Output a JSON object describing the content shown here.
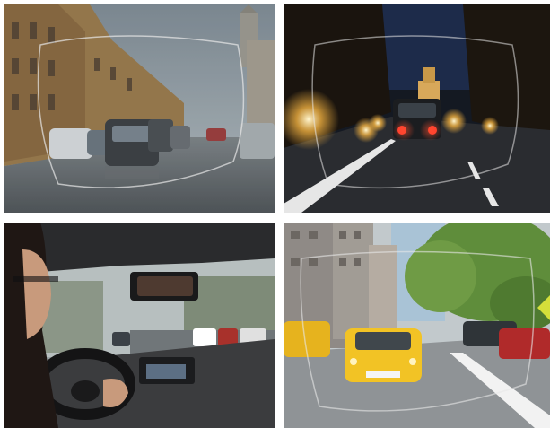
{
  "tiles": [
    {
      "scene": "rainy-city-street-through-lens"
    },
    {
      "scene": "night-street-headlights-through-lens"
    },
    {
      "scene": "car-interior-driver-rain"
    },
    {
      "scene": "taxi-city-street-through-lens"
    }
  ],
  "colors": {
    "accent_arrow": "#d4df3a",
    "lens_outline": "#e8e8e8"
  }
}
